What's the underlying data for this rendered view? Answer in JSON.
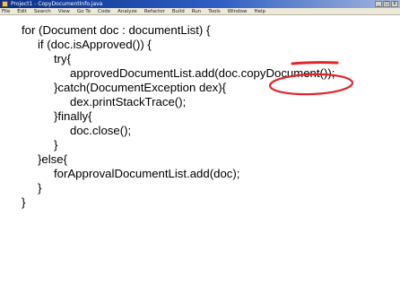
{
  "window": {
    "title": "Project1 - CopyDocumentInfo.java",
    "buttons": [
      "_",
      "□",
      "x"
    ]
  },
  "menu": {
    "items": [
      "File",
      "Edit",
      "Search",
      "View",
      "Go To",
      "Code",
      "Analyze",
      "Refactor",
      "Build",
      "Run",
      "Tools",
      "Window",
      "Help"
    ]
  },
  "editor": {
    "lines": [
      "for (Document doc : documentList) {",
      "if (doc.isApproved()) {",
      "try{",
      "approvedDocumentList.add(doc.copyDocument());",
      "}catch(DocumentException dex){",
      "dex.printStackTrace();",
      "}finally{",
      "doc.close();",
      "}",
      "}else{",
      "forApprovalDocumentList.add(doc);",
      "}",
      "}"
    ]
  },
  "annotation": {
    "color": "#e0262b",
    "highlighted_text": "copyDocument()"
  }
}
